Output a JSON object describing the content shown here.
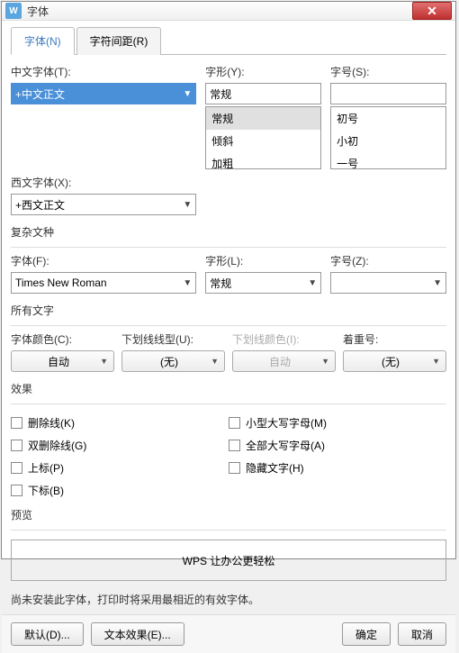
{
  "window": {
    "title": "字体",
    "icon_letter": "W"
  },
  "tabs": {
    "font": "字体(N)",
    "spacing": "字符间距(R)"
  },
  "top": {
    "cn_font_label": "中文字体(T):",
    "cn_font_value": "+中文正文",
    "style_label": "字形(Y):",
    "style_value": "常规",
    "style_options": [
      "常规",
      "倾斜",
      "加粗"
    ],
    "size_label": "字号(S):",
    "size_value": "",
    "size_options": [
      "初号",
      "小初",
      "一号"
    ],
    "en_font_label": "西文字体(X):",
    "en_font_value": "+西文正文"
  },
  "complex": {
    "title": "复杂文种",
    "font_label": "字体(F):",
    "font_value": "Times New Roman",
    "style_label": "字形(L):",
    "style_value": "常规",
    "size_label": "字号(Z):",
    "size_value": ""
  },
  "alltext": {
    "title": "所有文字",
    "color_label": "字体颜色(C):",
    "color_value": "自动",
    "underline_label": "下划线线型(U):",
    "underline_value": "(无)",
    "ucolor_label": "下划线颜色(I):",
    "ucolor_value": "自动",
    "emphasis_label": "着重号:",
    "emphasis_value": "(无)"
  },
  "effects": {
    "title": "效果",
    "left": [
      "删除线(K)",
      "双删除线(G)",
      "上标(P)",
      "下标(B)"
    ],
    "right": [
      "小型大写字母(M)",
      "全部大写字母(A)",
      "隐藏文字(H)"
    ]
  },
  "preview": {
    "title": "预览",
    "text": "WPS 让办公更轻松"
  },
  "note": "尚未安装此字体，打印时将采用最相近的有效字体。",
  "buttons": {
    "default": "默认(D)...",
    "text_effects": "文本效果(E)...",
    "ok": "确定",
    "cancel": "取消"
  }
}
